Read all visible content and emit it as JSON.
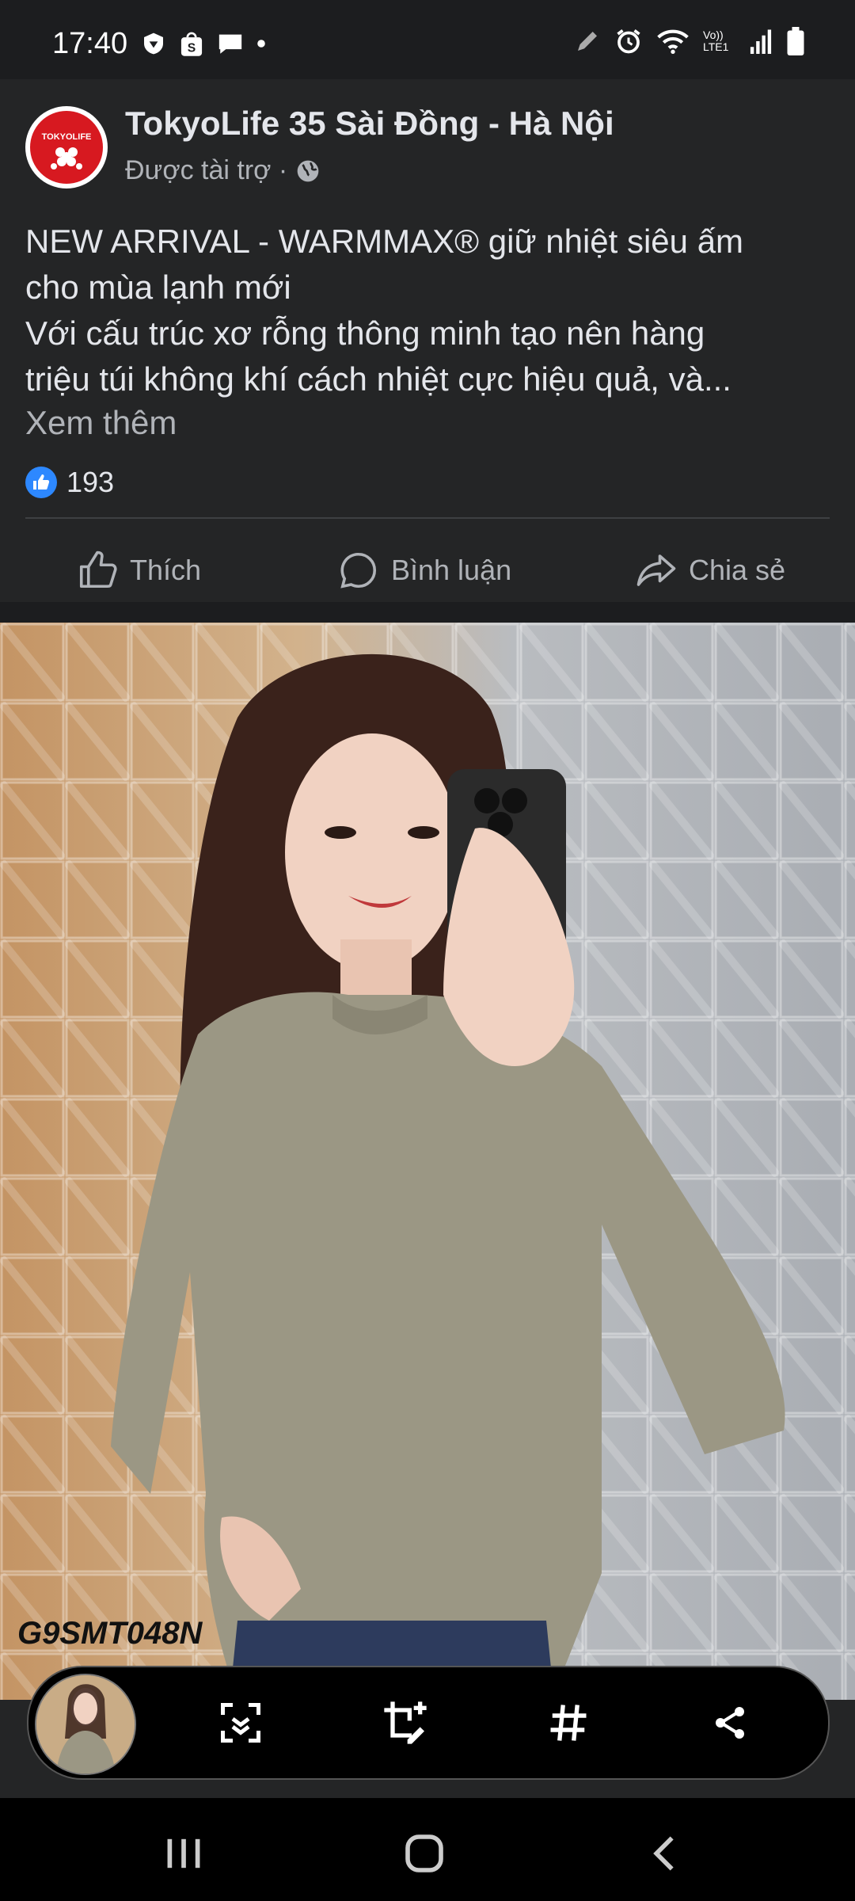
{
  "status_bar": {
    "time": "17:40",
    "icons_left": [
      "vpn-shield-icon",
      "shopee-icon",
      "messenger-icon",
      "dot-icon"
    ],
    "icons_right": [
      "pen-icon",
      "alarm-icon",
      "wifi-icon",
      "volte-icon",
      "signal-icon",
      "battery-icon"
    ],
    "volte_label": "Vo)) LTE1"
  },
  "post": {
    "page_name": "TokyoLife 35 Sài Đồng - Hà Nội",
    "avatar_brand": "TOKYOLIFE",
    "sponsored_label": "Được tài trợ ·",
    "caption_lines": [
      "NEW ARRIVAL - WARMMAX® giữ nhiệt siêu ấm",
      "cho mùa lạnh mới",
      "Với cấu trúc xơ rỗng thông minh tạo nên hàng",
      "triệu túi không khí cách nhiệt cực hiệu quả, và..."
    ],
    "see_more": "Xem thêm",
    "like_count": "193",
    "actions": {
      "like": "Thích",
      "comment": "Bình luận",
      "share": "Chia sẻ"
    }
  },
  "photo": {
    "watermark": "G9SMT048N"
  },
  "screenshot_toolbar": {
    "buttons": [
      "scan-icon",
      "crop-edit-icon",
      "hashtag-icon",
      "share-icon"
    ]
  },
  "colors": {
    "background": "#242526",
    "accent_blue": "#2d88ff",
    "brand_red": "#d71920"
  }
}
